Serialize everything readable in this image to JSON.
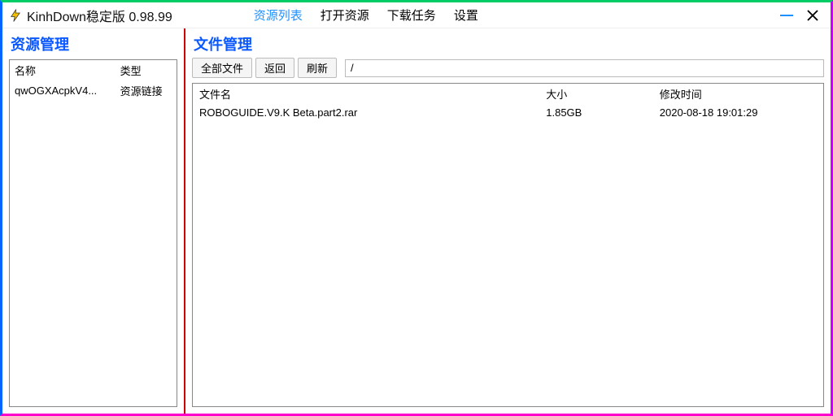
{
  "titlebar": {
    "title": "KinhDown稳定版 0.98.99",
    "nav": [
      {
        "label": "资源列表",
        "active": true
      },
      {
        "label": "打开资源",
        "active": false
      },
      {
        "label": "下载任务",
        "active": false
      },
      {
        "label": "设置",
        "active": false
      }
    ]
  },
  "left": {
    "title": "资源管理",
    "columns": {
      "name": "名称",
      "type": "类型"
    },
    "rows": [
      {
        "name": "qwOGXAcpkV4...",
        "type": "资源链接"
      }
    ]
  },
  "right": {
    "title": "文件管理",
    "toolbar": {
      "all": "全部文件",
      "back": "返回",
      "refresh": "刷新",
      "path": "/"
    },
    "columns": {
      "name": "文件名",
      "size": "大小",
      "mtime": "修改时间"
    },
    "rows": [
      {
        "name": "ROBOGUIDE.V9.K Beta.part2.rar",
        "size": "1.85GB",
        "mtime": "2020-08-18 19:01:29"
      }
    ]
  }
}
